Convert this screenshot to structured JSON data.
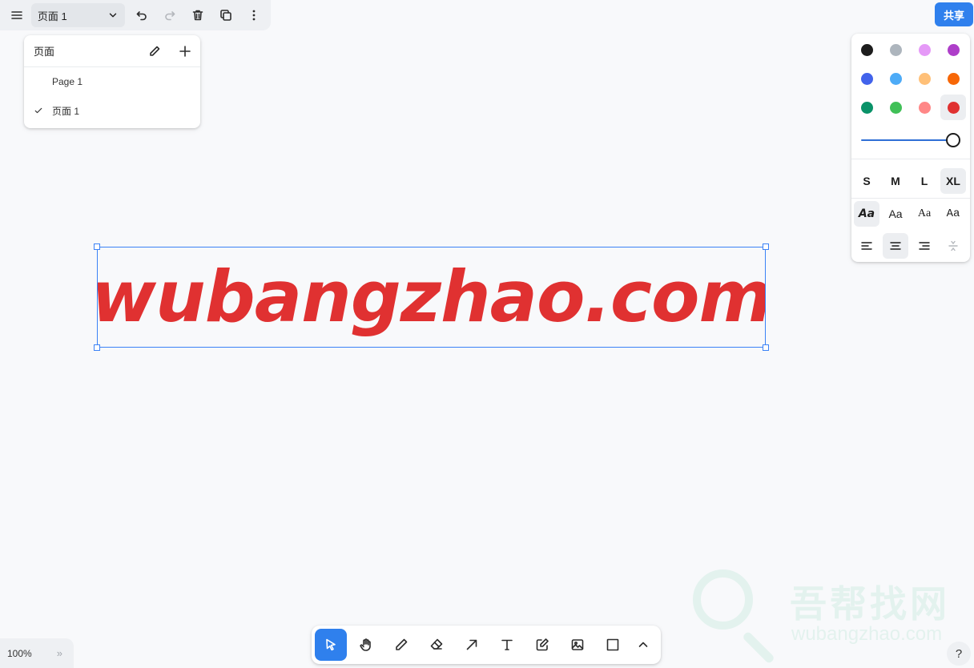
{
  "toolbar": {
    "page_select_value": "页面 1",
    "buttons": [
      "menu-icon",
      "undo-icon",
      "redo-icon",
      "trash-icon",
      "duplicate-icon",
      "more-icon"
    ]
  },
  "share": {
    "label": "共享"
  },
  "pages_panel": {
    "title": "页面",
    "items": [
      {
        "label": "Page 1",
        "checked": false
      },
      {
        "label": "页面 1",
        "checked": true
      }
    ]
  },
  "style_panel": {
    "colors": [
      "#1d1d1d",
      "#adb5bd",
      "#e599f7",
      "#ae3ec9",
      "#4263eb",
      "#4dabf7",
      "#ffc078",
      "#f76707",
      "#099268",
      "#40c057",
      "#ff8787",
      "#e03131"
    ],
    "selected_color": "#e03131",
    "opacity": 1,
    "sizes": [
      "S",
      "M",
      "L",
      "XL"
    ],
    "selected_size": "XL",
    "fonts": [
      "Aa",
      "Aa",
      "Aa",
      "Aa"
    ],
    "selected_font_index": 0,
    "selected_align_index": 1
  },
  "canvas": {
    "text": "wubangzhao.com",
    "text_color": "#e03131"
  },
  "watermark": {
    "title": "吾帮找网",
    "url": "wubangzhao.com"
  },
  "zoom": {
    "value": "100%",
    "expand": "»"
  },
  "tools": [
    "select-icon",
    "hand-icon",
    "pencil-icon",
    "eraser-icon",
    "arrow-icon",
    "text-icon",
    "note-icon",
    "image-icon",
    "rectangle-icon",
    "chevron-up-icon"
  ],
  "selected_tool": "select-icon",
  "help": {
    "label": "?"
  }
}
